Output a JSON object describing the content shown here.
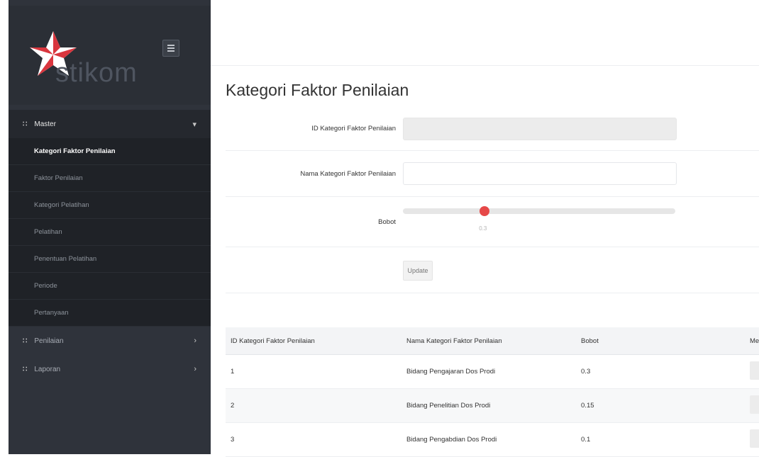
{
  "sidebar": {
    "logo_text": "stikom",
    "menu": {
      "master": {
        "label": "Master",
        "chevron": "chevron-down"
      },
      "items": [
        {
          "label": "Kategori Faktor Penilaian",
          "active": true
        },
        {
          "label": "Faktor Penilaian",
          "active": false
        },
        {
          "label": "Kategori Pelatihan",
          "active": false
        },
        {
          "label": "Pelatihan",
          "active": false
        },
        {
          "label": "Penentuan Pelatihan",
          "active": false
        },
        {
          "label": "Periode",
          "active": false
        },
        {
          "label": "Pertanyaan",
          "active": false
        }
      ],
      "penilaian": {
        "label": "Penilaian",
        "chevron": "chevron-right"
      },
      "laporan": {
        "label": "Laporan",
        "chevron": "chevron-right"
      }
    }
  },
  "page": {
    "title": "Kategori Faktor Penilaian",
    "form": {
      "id_label": "ID Kategori Faktor Penilaian",
      "id_value": "",
      "name_label": "Nama Kategori Faktor Penilaian",
      "name_value": "",
      "bobot_label": "Bobot",
      "bobot_value": 0.3,
      "bobot_display": "0.3",
      "bobot_min": 0,
      "bobot_max": 1,
      "update_label": "Update"
    },
    "table": {
      "headers": [
        "ID Kategori Faktor Penilaian",
        "Nama Kategori Faktor Penilaian",
        "Bobot",
        "Me"
      ],
      "rows": [
        [
          "1",
          "Bidang Pengajaran Dos Prodi",
          "0.3"
        ],
        [
          "2",
          "Bidang Penelitian Dos Prodi",
          "0.15"
        ],
        [
          "3",
          "Bidang Pengabdian Dos Prodi",
          "0.1"
        ]
      ]
    }
  },
  "colors": {
    "sidebar_bg": "#2f333b",
    "slider_thumb": "#e64848",
    "logo_red": "#d9363e"
  }
}
